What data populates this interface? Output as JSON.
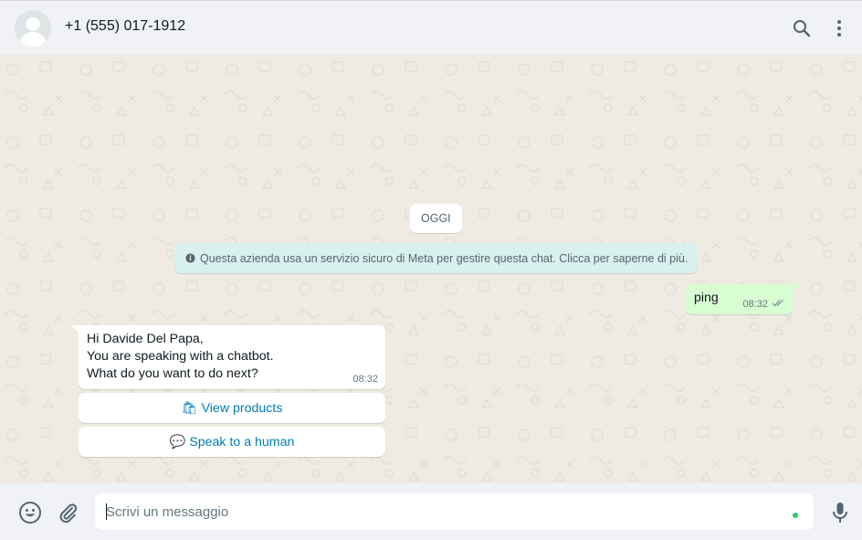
{
  "header": {
    "contact_name": "+1 (555) 017-1912",
    "icons": [
      "default-avatar",
      "search-icon",
      "menu-dots-icon"
    ]
  },
  "chat": {
    "date_chip": "OGGI",
    "info_notice": "Questa azienda usa un servizio sicuro di Meta per gestire questa chat. Clicca per saperne di più.",
    "outgoing": {
      "text": "ping",
      "time": "08:32",
      "status": "read"
    },
    "incoming": {
      "lines": [
        "Hi Davide Del Papa,",
        "You are speaking with a chatbot.",
        "What do you want to do next?"
      ],
      "time": "08:32"
    },
    "quick_replies": [
      {
        "emoji": "🛍",
        "label": "View products"
      },
      {
        "emoji": "💬",
        "label": "Speak to a human"
      }
    ]
  },
  "footer": {
    "placeholder": "Scrivi un messaggio",
    "icons": [
      "emoji-icon",
      "attach-icon",
      "mic-icon"
    ]
  },
  "colors": {
    "header_bg": "#f0f2f5",
    "chat_bg": "#efeae2",
    "outgoing_bubble": "#d9fdd3",
    "incoming_bubble": "#ffffff",
    "info_chip": "#d9f1ee",
    "link": "#027eb5",
    "read_ticks": "#8696a0"
  }
}
